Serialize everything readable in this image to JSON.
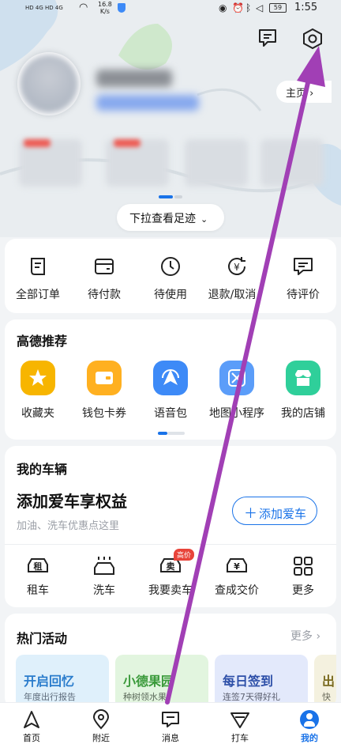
{
  "status": {
    "left": "HD 4G HD 4G",
    "speed_value": "16.8",
    "speed_unit": "K/s",
    "battery": "59",
    "time": "1:55"
  },
  "header": {
    "home_link": "主页",
    "pull_hint": "下拉查看足迹"
  },
  "orders": [
    {
      "label": "全部订单",
      "icon": "receipt-icon"
    },
    {
      "label": "待付款",
      "icon": "wallet-icon"
    },
    {
      "label": "待使用",
      "icon": "clock-icon"
    },
    {
      "label": "退款/取消",
      "icon": "refund-icon"
    },
    {
      "label": "待评价",
      "icon": "comment-icon"
    }
  ],
  "recommend": {
    "title": "高德推荐",
    "items": [
      {
        "label": "收藏夹",
        "icon": "star-icon",
        "color": "#f7b500"
      },
      {
        "label": "钱包卡券",
        "icon": "wallet-card-icon",
        "color": "#ffb020"
      },
      {
        "label": "语音包",
        "icon": "navigation-arrow-icon",
        "color": "#3d8af7"
      },
      {
        "label": "地图小程序",
        "icon": "mini-program-icon",
        "color": "#5b9df9"
      },
      {
        "label": "我的店铺",
        "icon": "shop-icon",
        "color": "#2fcf9a"
      }
    ]
  },
  "vehicle": {
    "title": "我的车辆",
    "headline": "添加爱车享权益",
    "subtitle": "加油、洗车优惠点这里",
    "add_button": "添加爱车",
    "add_icon": "plus-icon",
    "services": [
      {
        "label": "租车",
        "icon": "car-rent-icon",
        "glyph": "租"
      },
      {
        "label": "洗车",
        "icon": "car-wash-icon",
        "glyph": ""
      },
      {
        "label": "我要卖车",
        "icon": "car-sell-icon",
        "glyph": "卖",
        "badge": "高价"
      },
      {
        "label": "查成交价",
        "icon": "car-price-icon",
        "glyph": "¥"
      },
      {
        "label": "更多",
        "icon": "grid-icon",
        "glyph": ""
      }
    ]
  },
  "hot": {
    "title": "热门活动",
    "more": "更多",
    "cards": [
      {
        "title": "开启回忆",
        "subtitle": "年度出行报告",
        "color": "#2a7ccc",
        "bg": "#dff0fb"
      },
      {
        "title": "小德果园",
        "subtitle": "种树领水果",
        "color": "#3a9a3a",
        "bg": "#e2f5df"
      },
      {
        "title": "每日签到",
        "subtitle": "连签7天得好礼",
        "color": "#2d4fa8",
        "bg": "#e3e9fb"
      },
      {
        "title": "出",
        "subtitle": "快",
        "color": "#7a6b20",
        "bg": "#f4f1df"
      }
    ]
  },
  "tabbar": [
    {
      "label": "首页",
      "icon": "home-arrow-icon"
    },
    {
      "label": "附近",
      "icon": "location-pin-icon"
    },
    {
      "label": "消息",
      "icon": "message-icon"
    },
    {
      "label": "打车",
      "icon": "taxi-icon"
    },
    {
      "label": "我的",
      "icon": "profile-icon"
    }
  ],
  "colors": {
    "accent": "#1a73e8",
    "annotation": "#a13fb5",
    "badge": "#e8443a"
  }
}
